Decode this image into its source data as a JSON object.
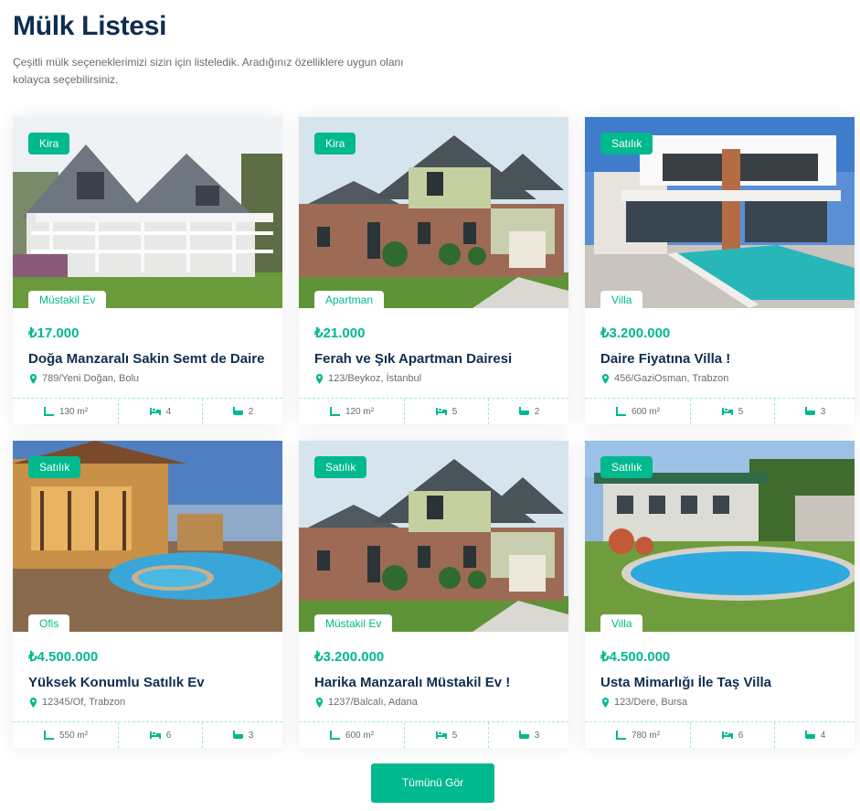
{
  "header": {
    "title": "Mülk Listesi",
    "description": "Çeşitli mülk seçeneklerimizi sizin için listeledik. Aradığınız özelliklere uygun olanı kolayca seçebilirsiniz."
  },
  "colors": {
    "accent": "#00b98e",
    "heading": "#0e2e50",
    "muted": "#666d73"
  },
  "listings": [
    {
      "status": "Kira",
      "type": "Müstakil Ev",
      "price": "₺17.000",
      "title": "Doğa Manzaralı Sakin Semt de Daire",
      "location": "789/Yeni Doğan, Bolu",
      "area": "130 m²",
      "beds": "4",
      "baths": "2",
      "image": "white-farmhouse"
    },
    {
      "status": "Kira",
      "type": "Apartman",
      "price": "₺21.000",
      "title": "Ferah ve Şık Apartman Dairesi",
      "location": "123/Beykoz, İstanbul",
      "area": "120 m²",
      "beds": "5",
      "baths": "2",
      "image": "brick-house"
    },
    {
      "status": "Satılık",
      "type": "Villa",
      "price": "₺3.200.000",
      "title": "Daire Fiyatına Villa !",
      "location": "456/GaziOsman, Trabzon",
      "area": "600 m²",
      "beds": "5",
      "baths": "3",
      "image": "modern-villa-pool"
    },
    {
      "status": "Satılık",
      "type": "Ofis",
      "price": "₺4.500.000",
      "title": "Yüksek Konumlu Satılık Ev",
      "location": "12345/Of, Trabzon",
      "area": "550 m²",
      "beds": "6",
      "baths": "3",
      "image": "dusk-mansion-pool"
    },
    {
      "status": "Satılık",
      "type": "Müstakil Ev",
      "price": "₺3.200.000",
      "title": "Harika Manzaralı Müstakil Ev !",
      "location": "1237/Balcalı, Adana",
      "area": "600 m²",
      "beds": "5",
      "baths": "3",
      "image": "brick-house"
    },
    {
      "status": "Satılık",
      "type": "Villa",
      "price": "₺4.500.000",
      "title": "Usta Mimarlığı İle Taş Villa",
      "location": "123/Dere, Bursa",
      "area": "780 m²",
      "beds": "6",
      "baths": "4",
      "image": "stone-villa-pool"
    }
  ],
  "icons": {
    "location": "map-marker-icon",
    "area": "ruler-icon",
    "beds": "bed-icon",
    "baths": "bath-icon"
  },
  "cta": {
    "label": "Tümünü Gör"
  }
}
